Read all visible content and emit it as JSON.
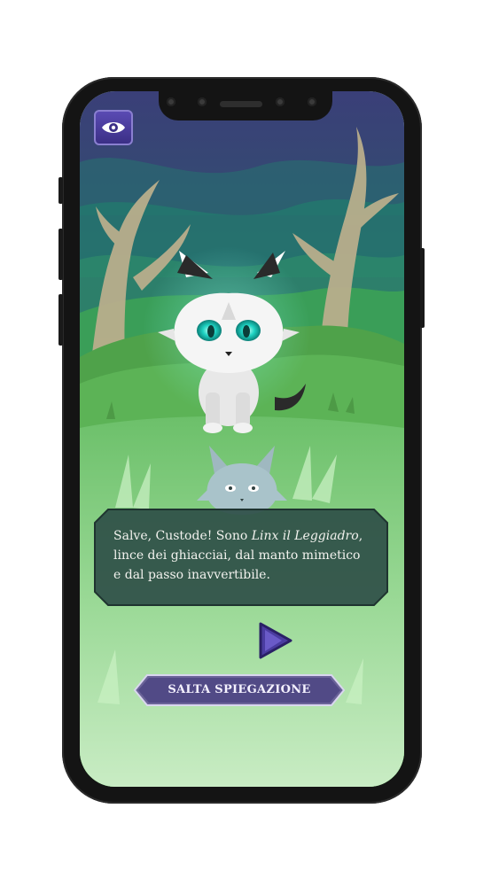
{
  "dialog": {
    "line1_before": "Salve, Custode! Sono ",
    "line1_italic": "Linx il Leggiadro",
    "line1_after": ",",
    "line2": "lince dei ghiacciai, dal manto mimetico",
    "line3": "e dal passo inavvertibile."
  },
  "skip_button": {
    "label": "SALTA SPIEGAZIONE"
  },
  "icons": {
    "top_left": "eye-icon",
    "next": "play-arrow-icon"
  },
  "colors": {
    "button_purple": "#4a3ca0",
    "dialog_bg": "#2f4f48",
    "lynx_eye": "#1fd3c3",
    "grass": "#5aa64e"
  }
}
